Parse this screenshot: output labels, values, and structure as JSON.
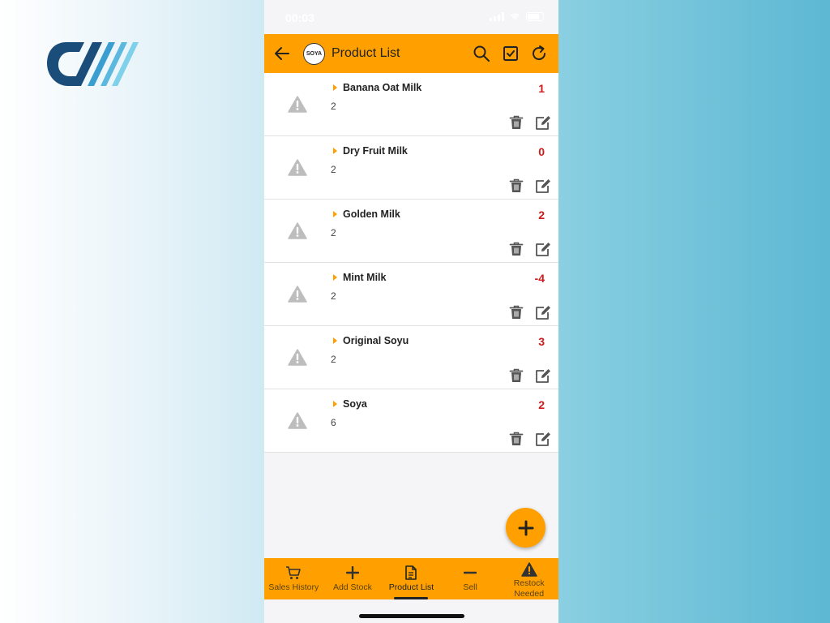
{
  "status_bar": {
    "time": "00:03"
  },
  "appbar": {
    "title": "Product List",
    "logo_text": "SOYA"
  },
  "products": [
    {
      "name": "Banana Oat Milk",
      "sub": "2",
      "qty": "1"
    },
    {
      "name": "Dry Fruit Milk",
      "sub": "2",
      "qty": "0"
    },
    {
      "name": "Golden Milk",
      "sub": "2",
      "qty": "2"
    },
    {
      "name": "Mint Milk",
      "sub": "2",
      "qty": "-4"
    },
    {
      "name": "Original Soyu",
      "sub": "2",
      "qty": "3"
    },
    {
      "name": "Soya",
      "sub": "6",
      "qty": "2"
    }
  ],
  "bottom_nav": {
    "sales_history": "Sales History",
    "add_stock": "Add Stock",
    "product_list": "Product List",
    "sell": "Sell",
    "restock_needed": "Restock Needed"
  },
  "colors": {
    "accent": "#FFA000",
    "qty": "#D11A1A",
    "warning_icon": "#BDBDBD"
  },
  "icons": {
    "appbar": [
      "back-arrow-icon",
      "search-icon",
      "checkbox-icon",
      "refresh-icon"
    ],
    "row": [
      "warning-icon",
      "trash-icon",
      "edit-icon"
    ],
    "nav": [
      "cart-icon",
      "plus-icon",
      "document-icon",
      "minus-icon",
      "warning-icon"
    ],
    "fab": "plus-icon"
  }
}
